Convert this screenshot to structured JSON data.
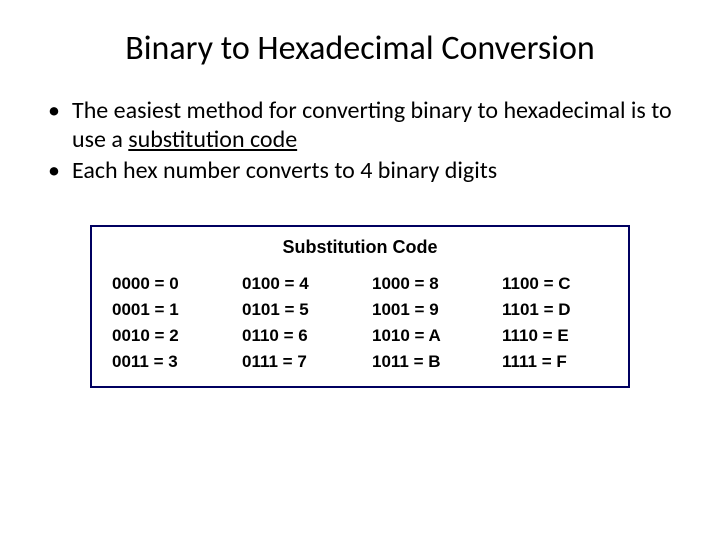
{
  "title": "Binary to Hexadecimal Conversion",
  "bullets": {
    "b1_pre": "The easiest method for converting binary to hexadecimal is to use a ",
    "b1_underlined": "substitution code",
    "b2": "Each hex number converts to 4 binary digits"
  },
  "codebox": {
    "heading": "Substitution Code",
    "cells": [
      "0000 = 0",
      "0100 = 4",
      "1000 = 8",
      "1100 = C",
      "0001 = 1",
      "0101 = 5",
      "1001 = 9",
      "1101 = D",
      "0010 = 2",
      "0110 = 6",
      "1010 = A",
      "1110 = E",
      "0011 = 3",
      "0111 = 7",
      "1011 = B",
      "1111 = F"
    ]
  }
}
